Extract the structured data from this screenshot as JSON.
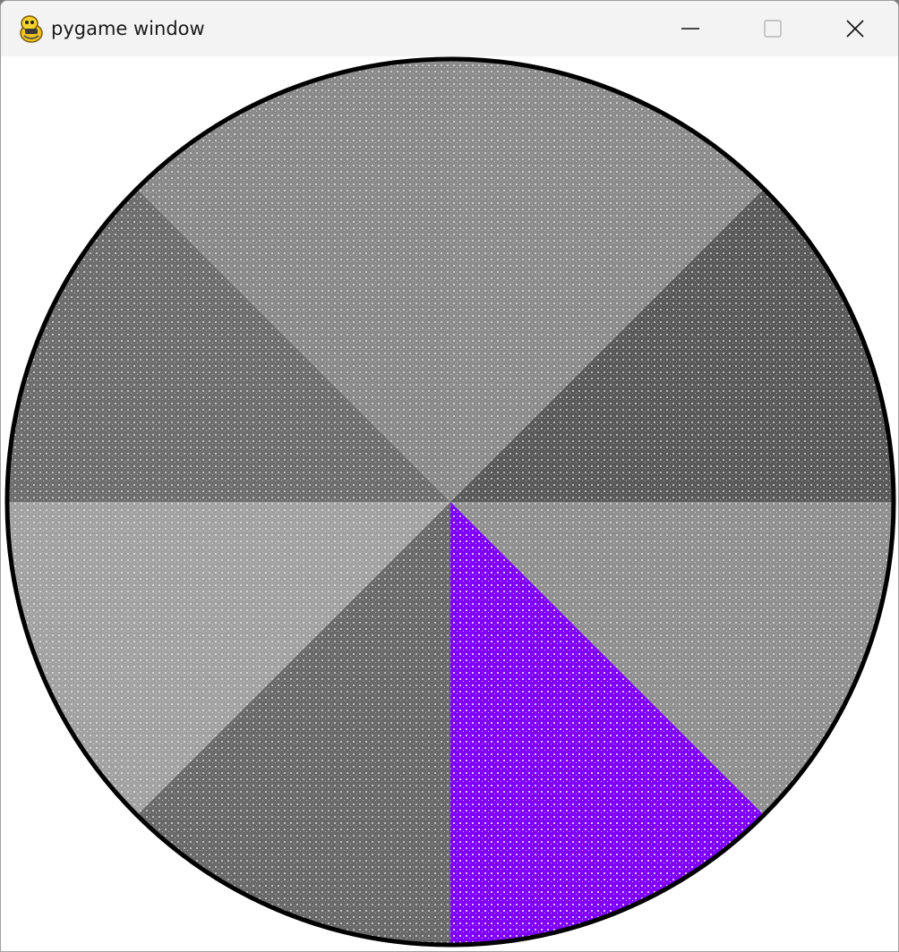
{
  "window": {
    "title": "pygame window",
    "icons": {
      "app": "pygame-snake-icon",
      "minimize": "minimize-icon",
      "maximize": "maximize-icon",
      "close": "close-icon"
    }
  },
  "canvas": {
    "background": "#ffffff",
    "outline_color": "#000000",
    "highlight_color": "#7f00ff",
    "slices": [
      {
        "id": "top-right",
        "color": "#8c8c8c"
      },
      {
        "id": "right-upper",
        "color": "#5a5a5a"
      },
      {
        "id": "right-lower",
        "color": "#909090"
      },
      {
        "id": "bottom-right",
        "color": "#7f00ff",
        "highlighted": true
      },
      {
        "id": "bottom-left",
        "color": "#6a6a6a"
      },
      {
        "id": "left-lower",
        "color": "#a2a2a2"
      },
      {
        "id": "left-upper",
        "color": "#6e6e6e"
      },
      {
        "id": "top-left",
        "color": "#8a8a8a"
      }
    ]
  }
}
